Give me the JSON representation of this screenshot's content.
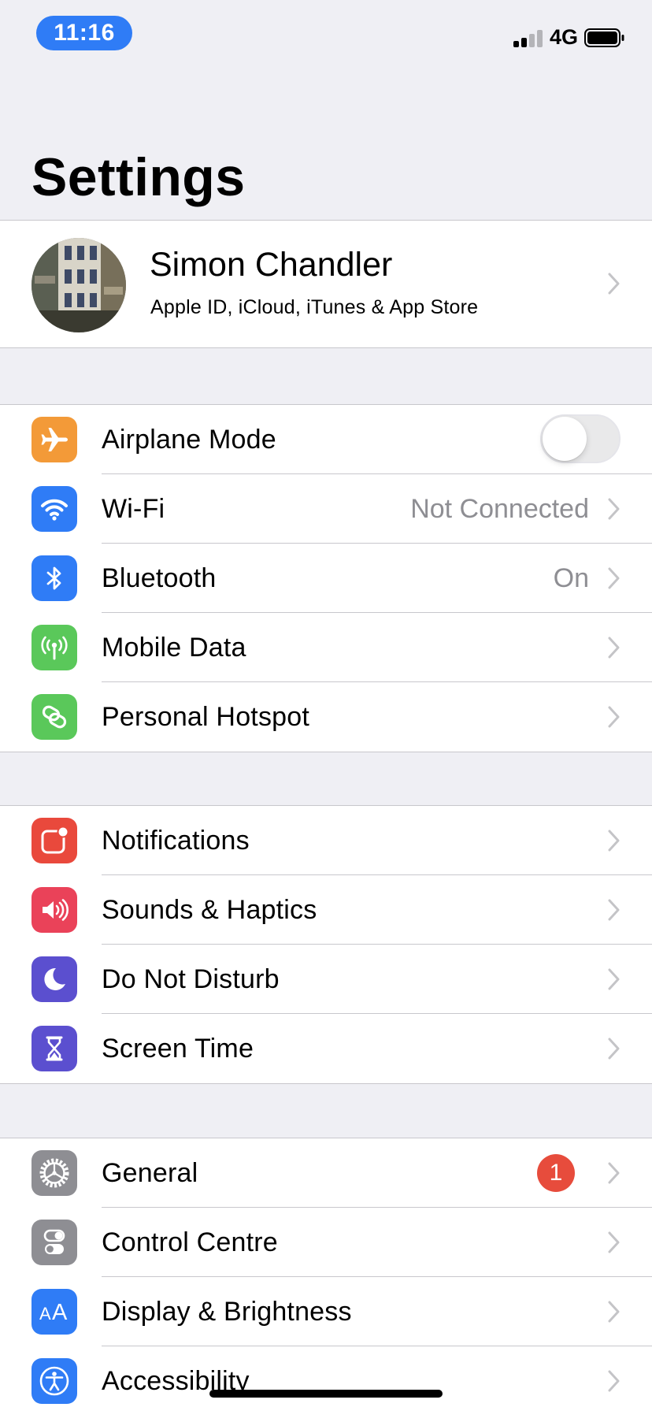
{
  "status_bar": {
    "time": "11:16",
    "network": "4G"
  },
  "title": "Settings",
  "profile": {
    "name": "Simon Chandler",
    "subtitle": "Apple ID, iCloud, iTunes & App Store"
  },
  "colors": {
    "orange": "#f39a38",
    "blue": "#2f7cf6",
    "green": "#5ac85a",
    "red": "#e9493c",
    "pink": "#ea4259",
    "purple": "#5b4fcf",
    "gray": "#8e8e93"
  },
  "groups": [
    {
      "rows": [
        {
          "name": "airplane-mode",
          "label": "Airplane Mode",
          "icon": "airplane-icon",
          "color": "#f39a38",
          "toggle": false
        },
        {
          "name": "wifi",
          "label": "Wi-Fi",
          "icon": "wifi-icon",
          "color": "#2f7cf6",
          "value": "Not Connected"
        },
        {
          "name": "bluetooth",
          "label": "Bluetooth",
          "icon": "bluetooth-icon",
          "color": "#2f7cf6",
          "value": "On"
        },
        {
          "name": "mobile-data",
          "label": "Mobile Data",
          "icon": "antenna-icon",
          "color": "#5ac85a"
        },
        {
          "name": "personal-hotspot",
          "label": "Personal Hotspot",
          "icon": "hotspot-icon",
          "color": "#5ac85a"
        }
      ]
    },
    {
      "rows": [
        {
          "name": "notifications",
          "label": "Notifications",
          "icon": "notifications-icon",
          "color": "#e9493c"
        },
        {
          "name": "sounds-haptics",
          "label": "Sounds & Haptics",
          "icon": "speaker-icon",
          "color": "#ea4259"
        },
        {
          "name": "do-not-disturb",
          "label": "Do Not Disturb",
          "icon": "moon-icon",
          "color": "#5b4fcf"
        },
        {
          "name": "screen-time",
          "label": "Screen Time",
          "icon": "hourglass-icon",
          "color": "#5b4fcf"
        }
      ]
    },
    {
      "rows": [
        {
          "name": "general",
          "label": "General",
          "icon": "gear-icon",
          "color": "#8e8e93",
          "badge": "1"
        },
        {
          "name": "control-centre",
          "label": "Control Centre",
          "icon": "switches-icon",
          "color": "#8e8e93"
        },
        {
          "name": "display-brightness",
          "label": "Display & Brightness",
          "icon": "text-size-icon",
          "color": "#2f7cf6"
        },
        {
          "name": "accessibility",
          "label": "Accessibility",
          "icon": "accessibility-icon",
          "color": "#2f7cf6"
        }
      ]
    }
  ]
}
